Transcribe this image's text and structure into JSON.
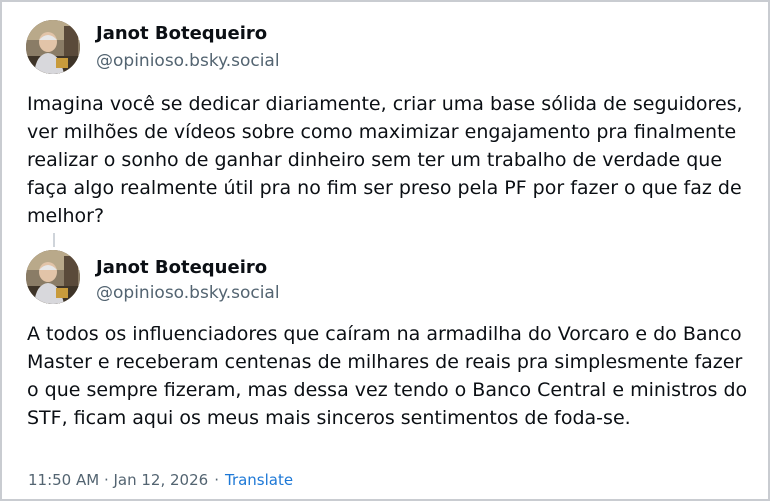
{
  "posts": [
    {
      "author_name": "Janot Botequeiro",
      "handle": "@opinioso.bsky.social",
      "text": "Imagina você se dedicar diariamente, criar uma base sólida de seguidores, ver milhões de vídeos sobre como maximizar engajamento pra finalmente realizar o sonho de ganhar dinheiro sem ter um trabalho de verdade que faça algo realmente útil pra no fim ser preso pela PF por fazer o que faz de melhor?"
    },
    {
      "author_name": "Janot Botequeiro",
      "handle": "@opinioso.bsky.social",
      "text": "A todos os influenciadores que caíram na armadilha do Vorcaro e do Banco Master e receberam centenas de milhares de reais pra simplesmente fazer o que sempre fizeram, mas dessa vez tendo o Banco Central e ministros do STF, ficam aqui os meus mais sinceros sentimentos de foda-se."
    }
  ],
  "meta": {
    "timestamp": "11:50 AM · Jan 12, 2026",
    "separator": "·",
    "translate_label": "Translate"
  },
  "colors": {
    "text": "#0b0f14",
    "muted": "#536471",
    "link": "#1d78d6",
    "border": "#c9ccd1"
  }
}
